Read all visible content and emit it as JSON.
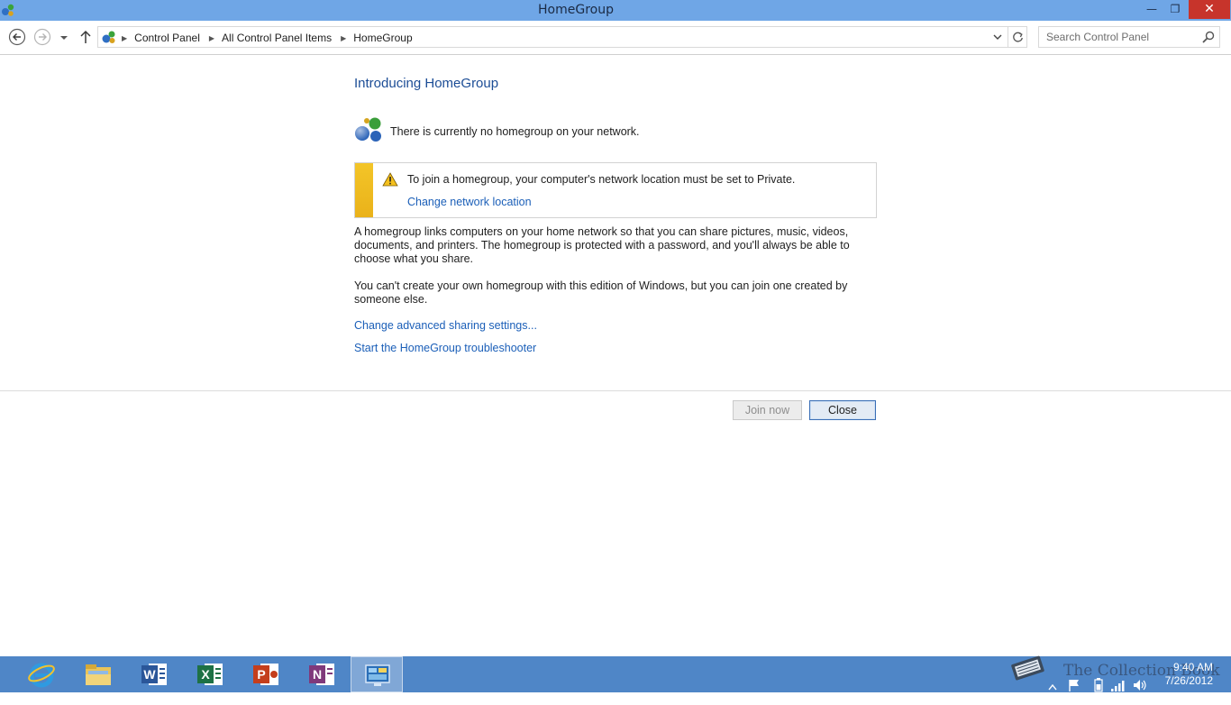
{
  "window": {
    "title": "HomeGroup",
    "minimize_glyph": "—",
    "maximize_glyph": "❐",
    "close_glyph": "✕"
  },
  "navigation": {
    "breadcrumbs": [
      "Control Panel",
      "All Control Panel Items",
      "HomeGroup"
    ],
    "search_placeholder": "Search Control Panel"
  },
  "content": {
    "heading": "Introducing HomeGroup",
    "status_text": "There is currently no homegroup on your network.",
    "warning_text": "To join a homegroup, your computer's network location must be set to Private.",
    "warning_link": "Change network location",
    "paragraph1": "A homegroup links computers on your home network so that you can share pictures, music, videos, documents, and printers. The homegroup is protected with a password, and you'll always be able to choose what you share.",
    "paragraph2": "You can't create your own homegroup with this edition of Windows, but you can join one created by someone else.",
    "link_advanced": "Change advanced sharing settings...",
    "link_troubleshooter": "Start the HomeGroup troubleshooter"
  },
  "buttons": {
    "join": "Join now",
    "close": "Close"
  },
  "taskbar": {
    "apps": [
      "internet-explorer-icon",
      "file-explorer-icon",
      "word-icon",
      "excel-icon",
      "powerpoint-icon",
      "onenote-icon",
      "control-panel-icon"
    ],
    "watermark": "The Collection Book",
    "time": "9:40 AM",
    "date": "7/26/2012"
  },
  "colors": {
    "titlebar": "#6fa6e6",
    "close_button": "#c7342b",
    "link": "#1b5fb8",
    "heading": "#1c4d96",
    "warning_bar": "#f0bf25",
    "taskbar": "#4f86c7"
  }
}
